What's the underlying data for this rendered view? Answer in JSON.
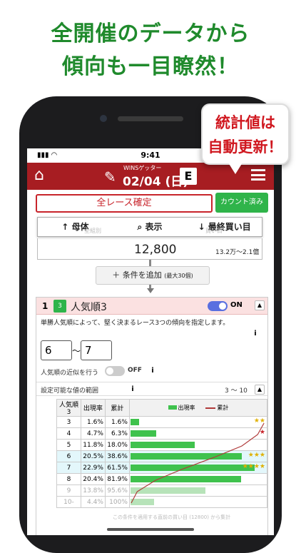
{
  "headline": {
    "line1": "全開催のデータから",
    "line2": "傾向も一目瞭然！"
  },
  "bubble": {
    "line1": "統計値は",
    "line2": "自動更新！"
  },
  "status_bar": {
    "time": "9:41"
  },
  "app_header": {
    "subtitle": "WINSゲッター",
    "date": "02/04 (日)",
    "grade": "E",
    "icons": [
      "home-icon",
      "edit-icon",
      "menu-icon"
    ]
  },
  "race_bar": {
    "race_button": "全レース確定",
    "count_button": "カウント済み"
  },
  "tabs": {
    "population": "母体",
    "display": "表示",
    "last_bet": "最終買い目",
    "ghost_left": "全組別",
    "ghost_right": "買い目"
  },
  "summary": {
    "count": "12,800",
    "range": "13.2万〜2.1億"
  },
  "add_condition": {
    "label": "＋ 条件を追加",
    "note": "(最大30個)"
  },
  "condition": {
    "number": "1",
    "icon_label": "3",
    "title": "人気順3",
    "toggle": "ON",
    "collapse": "▲",
    "description": "単勝人気順によって、堅く決まるレース3つの傾向を指定します。",
    "info": "i",
    "from": "6",
    "to": "7",
    "tilde": "〜",
    "approx_label": "人気順の近似を行う",
    "approx_state": "OFF",
    "range_label": "設定可能な値の範囲",
    "range_value": "3 〜 10"
  },
  "table": {
    "headers": [
      "人気順3",
      "出現率",
      "累計"
    ],
    "legend": {
      "rate": "出現率",
      "cumulative": "累計"
    },
    "accent_green": "#3fc24d",
    "accent_red": "#b03a3a",
    "rows": [
      {
        "rank": "3",
        "rate": "1.6%",
        "cum": "1.6%",
        "rate_value": 1.6,
        "cum_value": 1.6,
        "stars": "★★",
        "star_color": "#e0b000"
      },
      {
        "rank": "4",
        "rate": "4.7%",
        "cum": "6.3%",
        "rate_value": 4.7,
        "cum_value": 6.3,
        "stars": "★",
        "star_color": "#c8242b"
      },
      {
        "rank": "5",
        "rate": "11.8%",
        "cum": "18.0%",
        "rate_value": 11.8,
        "cum_value": 18.0,
        "stars": "",
        "star_color": ""
      },
      {
        "rank": "6",
        "rate": "20.5%",
        "cum": "38.6%",
        "rate_value": 20.5,
        "cum_value": 38.6,
        "stars": "★★★",
        "star_color": "#e0b000"
      },
      {
        "rank": "7",
        "rate": "22.9%",
        "cum": "61.5%",
        "rate_value": 22.9,
        "cum_value": 61.5,
        "stars": "★★★★",
        "star_color": "#e0b000"
      },
      {
        "rank": "8",
        "rate": "20.4%",
        "cum": "81.9%",
        "rate_value": 20.4,
        "cum_value": 81.9,
        "stars": "",
        "star_color": ""
      },
      {
        "rank": "9",
        "rate": "13.8%",
        "cum": "95.6%",
        "rate_value": 13.8,
        "cum_value": 95.6,
        "stars": "",
        "star_color": ""
      },
      {
        "rank": "10-",
        "rate": "4.4%",
        "cum": "100%",
        "rate_value": 4.4,
        "cum_value": 100,
        "stars": "",
        "star_color": ""
      }
    ]
  },
  "footer_note": "この条件を適用する直前の買い目 (12800) から集計"
}
